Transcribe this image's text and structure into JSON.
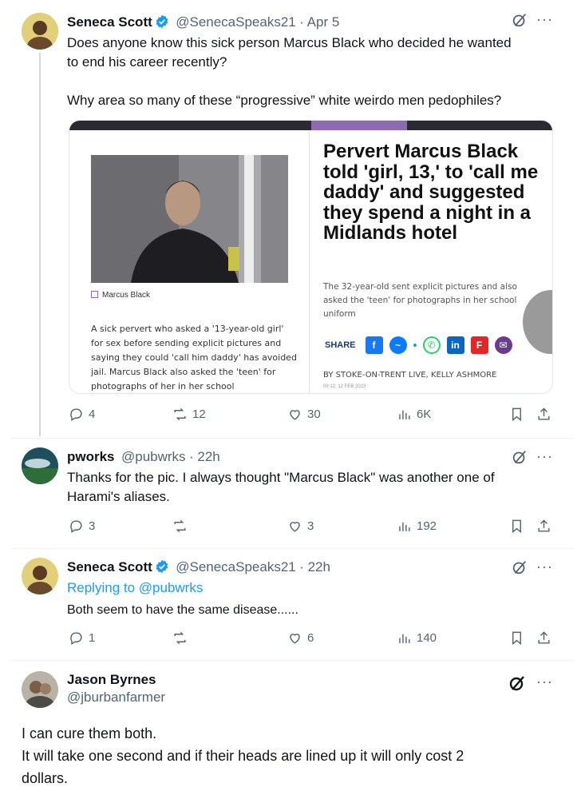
{
  "tweets": [
    {
      "name": "Seneca Scott",
      "handle": "@SenecaSpeaks21",
      "time": "· Apr 5",
      "text_line1": "Does anyone know this sick person Marcus Black who decided he wanted",
      "text_line2": "to end his career recently?",
      "text_line3": "Why area so many of these “progressive” white weirdo men pedophiles?",
      "stats": {
        "replies": "4",
        "retweets": "12",
        "likes": "30",
        "views": "6K"
      }
    },
    {
      "name": "pworks",
      "handle": "@pubwrks",
      "time": "· 22h",
      "text_line1": "Thanks for the pic. I always thought \"Marcus Black\" was another one of",
      "text_line2": "Harami's aliases.",
      "stats": {
        "replies": "3",
        "retweets": "",
        "likes": "3",
        "views": "192"
      }
    },
    {
      "name": "Seneca Scott",
      "handle": "@SenecaSpeaks21",
      "time": "· 22h",
      "replying_prefix": "Replying to ",
      "replying_to": "@pubwrks",
      "text_line1": "Both seem to have the same disease......",
      "stats": {
        "replies": "1",
        "retweets": "",
        "likes": "6",
        "views": "140"
      }
    },
    {
      "name": "Jason Byrnes",
      "handle": "@jburbanfarmer",
      "text_line1": "I can cure them both.",
      "text_line2": "It will take one second and if their heads are lined up it will only cost 2",
      "text_line3": "dollars."
    }
  ],
  "card": {
    "headline": "Pervert Marcus Black told 'girl, 13,' to 'call me daddy' and suggested they spend a night in a Midlands hotel",
    "photo_caption": "Marcus Black",
    "body": "A sick pervert who asked a '13-year-old girl' for sex before sending explicit pictures and saying they could 'call him daddy' has avoided jail. Marcus Black also asked the 'teen' for photographs of her in her school",
    "subheadline": "The 32-year-old sent explicit pictures and also asked the 'teen' for photographs in her school uniform",
    "share_label": "SHARE",
    "byline": "BY STOKE-ON-TRENT LIVE, KELLY ASHMORE",
    "date": "09:12, 12 FEB 2023"
  },
  "icons": {
    "verified": "verified-badge-icon",
    "grok": "grok-icon",
    "more": "more-icon",
    "reply": "reply-icon",
    "retweet": "retweet-icon",
    "like": "like-icon",
    "views": "views-icon",
    "bookmark": "bookmark-icon",
    "share": "share-icon"
  },
  "colors": {
    "accent": "#1d9bf0",
    "verified": "#1d9bf0",
    "muted": "#536471",
    "card_dark": "#2a2a32",
    "card_purple": "#8e6bb0"
  }
}
